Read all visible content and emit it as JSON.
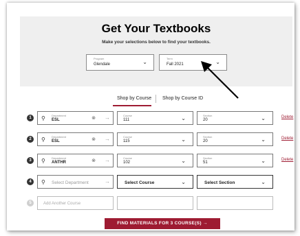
{
  "hero": {
    "title": "Get Your Textbooks",
    "subtitle": "Make your selections below to find your textbooks.",
    "program": {
      "label": "Program",
      "value": "Glendale"
    },
    "term": {
      "label": "Term",
      "value": "Fall 2021"
    }
  },
  "tabs": {
    "by_course": "Shop by Course",
    "by_course_id": "Shop by Course ID"
  },
  "rows": [
    {
      "num": "1",
      "dept_label": "Department",
      "dept": "ESL",
      "course_label": "Course",
      "course": "111",
      "section_label": "Section",
      "section": "20",
      "delete": "Delete"
    },
    {
      "num": "2",
      "dept_label": "Department",
      "dept": "ESL",
      "course_label": "Course",
      "course": "115",
      "section_label": "Section",
      "section": "20",
      "delete": "Delete"
    },
    {
      "num": "3",
      "dept_label": "Department",
      "dept": "ANTHR",
      "course_label": "Course",
      "course": "102",
      "section_label": "Section",
      "section": "51",
      "delete": "Delete"
    }
  ],
  "new_row": {
    "num": "4",
    "dept_placeholder": "Select Department",
    "course_placeholder": "Select Course",
    "section_placeholder": "Select Section"
  },
  "add_row": {
    "num": "5",
    "placeholder": "Add Another Course"
  },
  "cta_label": "FIND MATERIALS FOR 3 COURSE(S) →",
  "colors": {
    "accent": "#9e1b32",
    "hero_bg": "#efefef"
  },
  "icons": {
    "search": "search-icon",
    "clear": "clear-icon",
    "chevron": "chevron-down-icon",
    "arrow": "arrow-right-icon"
  }
}
